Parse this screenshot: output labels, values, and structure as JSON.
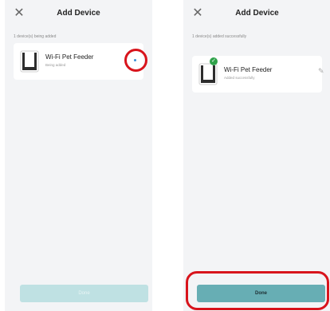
{
  "screens": [
    {
      "title": "Add Device",
      "close_glyph": "✕",
      "count_text": "1 device(s) being added",
      "device": {
        "name": "Wi-Fi Pet Feeder",
        "status": "Being added",
        "icon": "pet-feeder-icon"
      },
      "status_indicator": "loading-dot",
      "done_label": "Done",
      "done_state": "disabled"
    },
    {
      "title": "Add Device",
      "close_glyph": "✕",
      "count_text": "1 device(s) added successfully",
      "device": {
        "name": "Wi-Fi Pet Feeder",
        "status": "Added successfully",
        "icon": "pet-feeder-icon",
        "badge": "check-icon",
        "badge_glyph": "✓"
      },
      "edit_glyph": "✎",
      "done_label": "Done",
      "done_state": "enabled"
    }
  ],
  "colors": {
    "background": "#f3f4f6",
    "card": "#ffffff",
    "accent_teal": "#67aeb4",
    "disabled_teal": "#bfe1e3",
    "highlight_red": "#d8141c",
    "success_green": "#2fa24a"
  }
}
